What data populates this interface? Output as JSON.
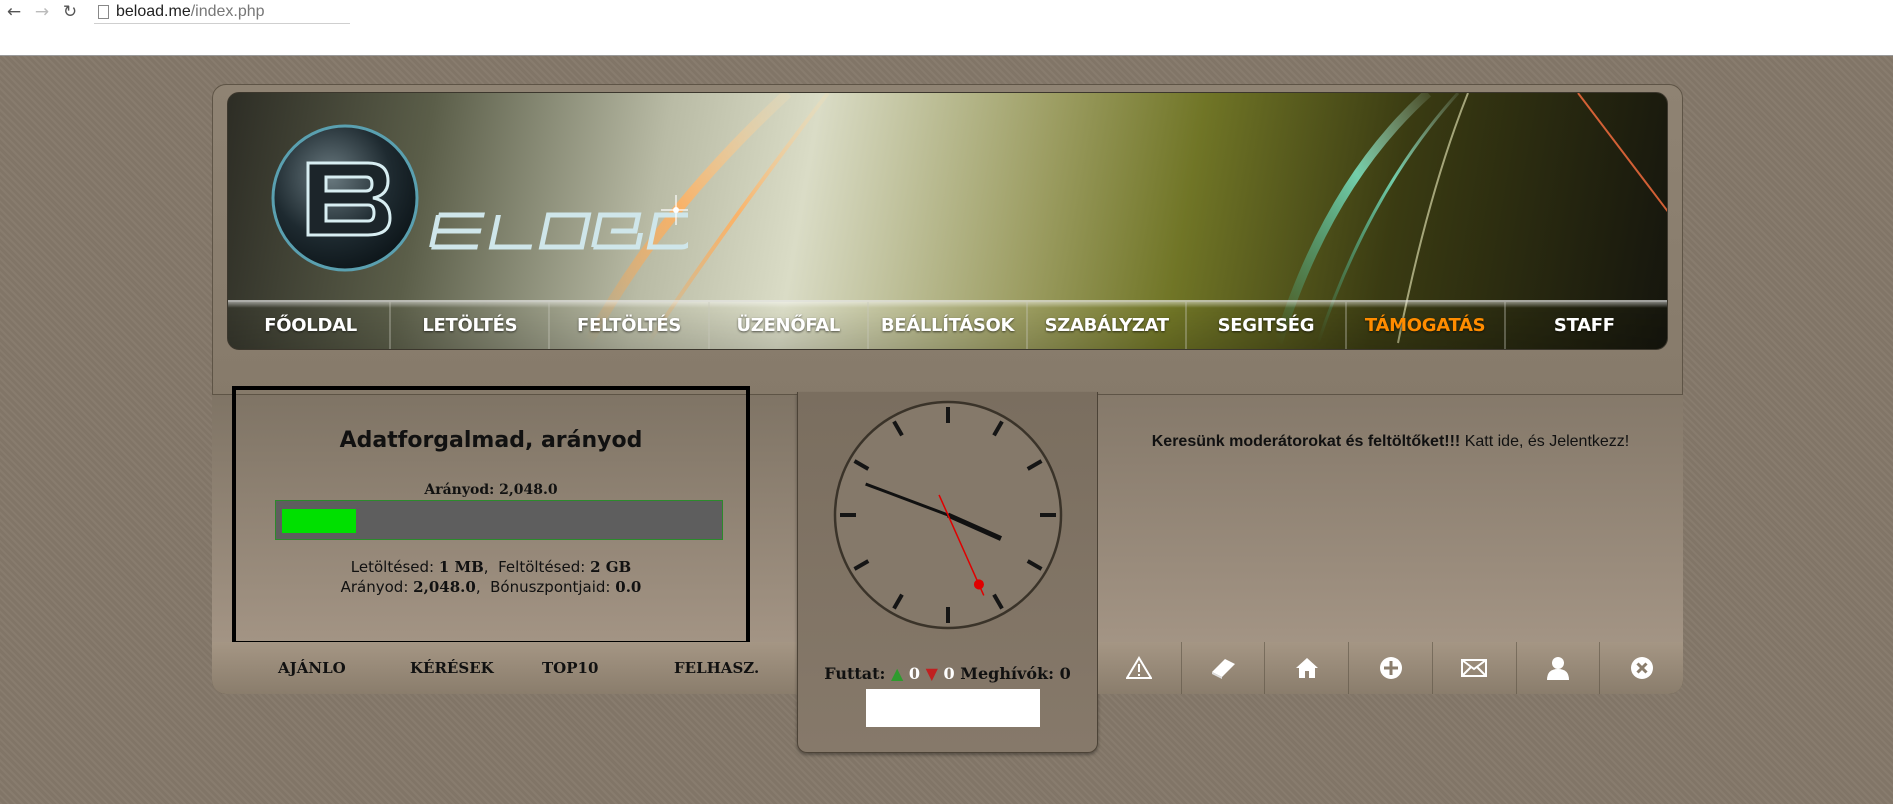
{
  "browser": {
    "url_host": "beload.me",
    "url_path": "/index.php"
  },
  "nav": {
    "items": [
      {
        "label": "FŐOLDAL"
      },
      {
        "label": "LETÖLTÉS"
      },
      {
        "label": "FELTÖLTÉS"
      },
      {
        "label": "ÜZENŐFAL"
      },
      {
        "label": "BEÁLLÍTÁSOK"
      },
      {
        "label": "SZABÁLYZAT"
      },
      {
        "label": "SEGITSÉG"
      },
      {
        "label": "TÁMOGATÁS",
        "active": true
      },
      {
        "label": "STAFF"
      }
    ]
  },
  "stats": {
    "title": "Adatforgalmad, arányod",
    "ratio_caption": "Arányod: 2,048.0",
    "ratio_fill_fraction": 0.17,
    "download_label": "Letöltésed:",
    "download_value": "1 MB",
    "upload_label": "Feltöltésed:",
    "upload_value": "2 GB",
    "ratio_label": "Arányod:",
    "ratio_value": "2,048.0",
    "bonus_label": "Bónuszpontjaid:",
    "bonus_value": "0.0"
  },
  "bottom_menu": {
    "items": [
      "AJÁNLO",
      "KÉRÉSEK",
      "TOP10",
      "FELHASZ."
    ]
  },
  "clock": {
    "hours": 3,
    "minutes": 48,
    "seconds": 26
  },
  "status": {
    "running_label": "Futtat:",
    "seeding": "0",
    "leeching": "0",
    "invites_label": "Meghívók:",
    "invites": "0"
  },
  "announcement": {
    "bold_text": "Keresünk moderátorokat és feltöltőket!!!",
    "text": " Katt ide, és Jelentkezz!"
  },
  "icons": [
    "warning-icon",
    "book-icon",
    "home-icon",
    "add-icon",
    "mail-icon",
    "user-icon",
    "close-icon"
  ],
  "colors": {
    "active_nav": "#ff8c00",
    "ratio_fill": "#00e000",
    "seed_arrow": "#2e9b2e",
    "leech_arrow": "#c02020"
  }
}
